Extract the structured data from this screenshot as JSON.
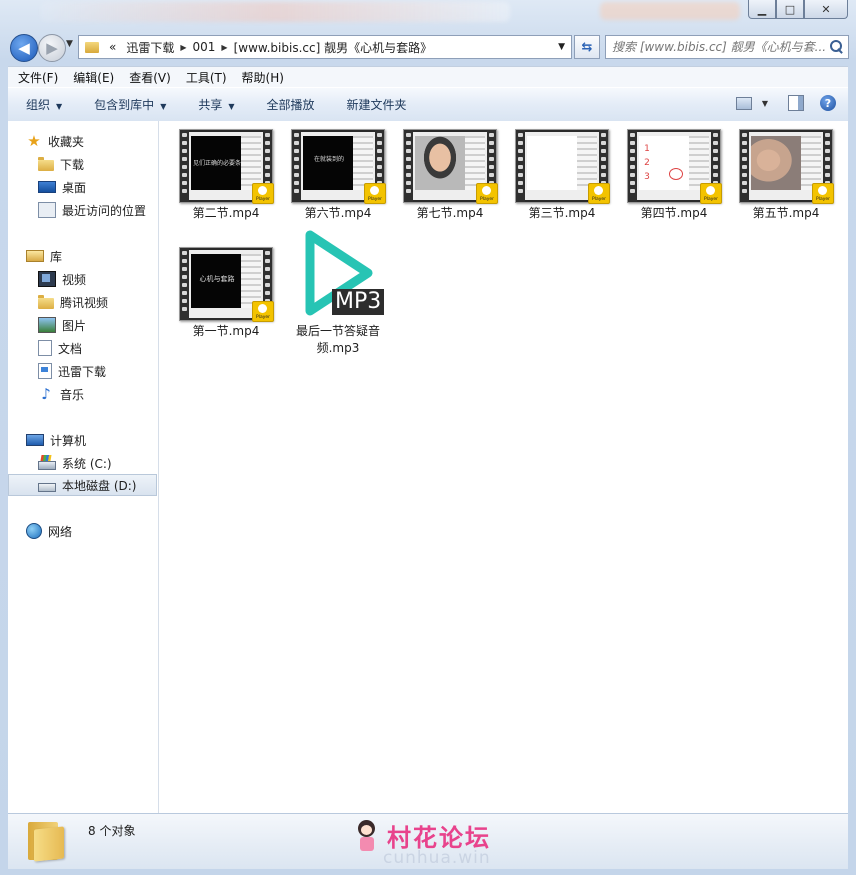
{
  "window": {
    "minimize": "▁",
    "maximize": "□",
    "close": "✕"
  },
  "nav": {
    "back_arrow": "◀",
    "forward_arrow": "▶",
    "breadcrumb": [
      "«",
      "迅雷下载",
      "001",
      "[www.bibis.cc] 靓男《心机与套路》"
    ],
    "search_placeholder": "搜索 [www.bibis.cc] 靓男《心机与套..."
  },
  "menu": [
    "文件(F)",
    "编辑(E)",
    "查看(V)",
    "工具(T)",
    "帮助(H)"
  ],
  "toolbar": {
    "organize": "组织",
    "include_library": "包含到库中",
    "share": "共享",
    "play_all": "全部播放",
    "new_folder": "新建文件夹",
    "help": "?"
  },
  "sidebar": {
    "favorites": "收藏夹",
    "downloads": "下载",
    "desktop": "桌面",
    "recent": "最近访问的位置",
    "libraries": "库",
    "videos": "视频",
    "tencent_video": "腾讯视频",
    "pictures": "图片",
    "documents": "文档",
    "xunlei": "迅雷下载",
    "music": "音乐",
    "computer": "计算机",
    "drive_c": "系统 (C:)",
    "drive_d": "本地磁盘 (D:)",
    "network": "网络"
  },
  "files": [
    {
      "name": "第二节.mp4",
      "thumb_text": "见们正确的必要条件",
      "kind": "slide"
    },
    {
      "name": "第六节.mp4",
      "thumb_text": "在就装到的",
      "kind": "slide"
    },
    {
      "name": "第七节.mp4",
      "thumb_text": "",
      "kind": "face"
    },
    {
      "name": "第三节.mp4",
      "thumb_text": "",
      "kind": "white"
    },
    {
      "name": "第四节.mp4",
      "thumb_text": "",
      "kind": "red"
    },
    {
      "name": "第五节.mp4",
      "thumb_text": "",
      "kind": "face2"
    },
    {
      "name": "第一节.mp4",
      "thumb_text": "心机与套路",
      "kind": "slide"
    },
    {
      "name": "最后一节答疑音频.mp3",
      "name_line1": "最后一节答疑音",
      "name_line2": "频.mp3",
      "kind": "mp3",
      "tag": "MP3"
    }
  ],
  "status": {
    "count": "8 个对象"
  },
  "watermark": {
    "title": "村花论坛",
    "url": "cunhua.win"
  },
  "colors": {
    "mp3_play": "#27c4b4",
    "badge": "#f3c300",
    "watermark": "#e8438c"
  }
}
